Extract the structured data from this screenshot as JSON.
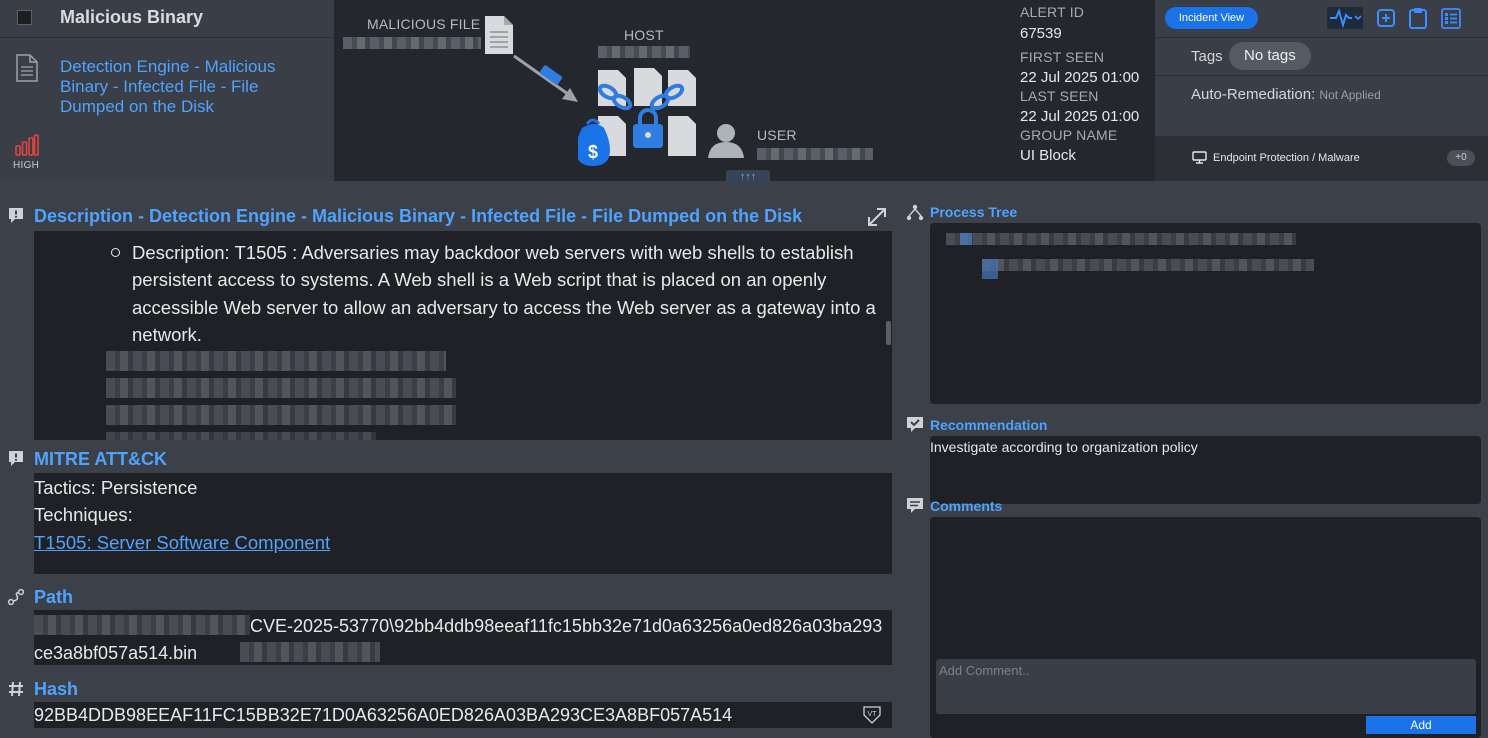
{
  "header": {
    "alert_title": "Malicious Binary",
    "alert_name": "Detection Engine - Malicious Binary - Infected File - File Dumped on the Disk",
    "severity": "HIGH",
    "diagram": {
      "malicious_file_label": "MALICIOUS FILE",
      "host_label": "HOST",
      "user_label": "USER",
      "collapse_glyph": "↑↑↑"
    },
    "meta": {
      "alert_id_label": "ALERT ID",
      "alert_id": "67539",
      "first_seen_label": "FIRST SEEN",
      "first_seen": "22 Jul 2025 01:00",
      "last_seen_label": "LAST SEEN",
      "last_seen": "22 Jul 2025 01:00",
      "group_name_label": "GROUP NAME",
      "group_name": "UI Block"
    },
    "right": {
      "incident_view": "Incident View",
      "tags_label": "Tags",
      "tags_value": "No tags",
      "auto_remediation_label": "Auto-Remediation:",
      "auto_remediation_value": "Not Applied",
      "endpoint_label": "Endpoint Protection / Malware",
      "endpoint_count": "+0"
    }
  },
  "description": {
    "title": "Description - Detection Engine - Malicious Binary - Infected File - File Dumped on the Disk",
    "text": "Description: T1505 : Adversaries may backdoor web servers with web shells to establish persistent access to systems. A Web shell is a Web script that is placed on an openly accessible Web server to allow an adversary to access the Web server as a gateway into a network."
  },
  "mitre": {
    "title": "MITRE ATT&CK",
    "tactics": "Tactics: Persistence",
    "techniques_label": "Techniques:",
    "technique_link": "T1505: Server Software Component"
  },
  "path": {
    "title": "Path",
    "visible_value": "CVE-2025-53770\\92bb4ddb98eeaf11fc15bb32e71d0a63256a0ed826a03ba293ce3a8bf057a514.bin"
  },
  "hash": {
    "title": "Hash",
    "value": "92BB4DDB98EEAF11FC15BB32E71D0A63256A0ED826A03BA293CE3A8BF057A514",
    "vt_badge": "VT"
  },
  "process_tree": {
    "title": "Process Tree"
  },
  "recommendation": {
    "title": "Recommendation",
    "text": "Investigate according to organization policy"
  },
  "comments": {
    "title": "Comments",
    "placeholder": "Add Comment..",
    "add_button": "Add"
  },
  "colors": {
    "accent": "#4fa3ff",
    "primary_button": "#1a73e8",
    "severity": "#e04545",
    "panel": "#3a3e46",
    "content_box": "#1f2126"
  }
}
